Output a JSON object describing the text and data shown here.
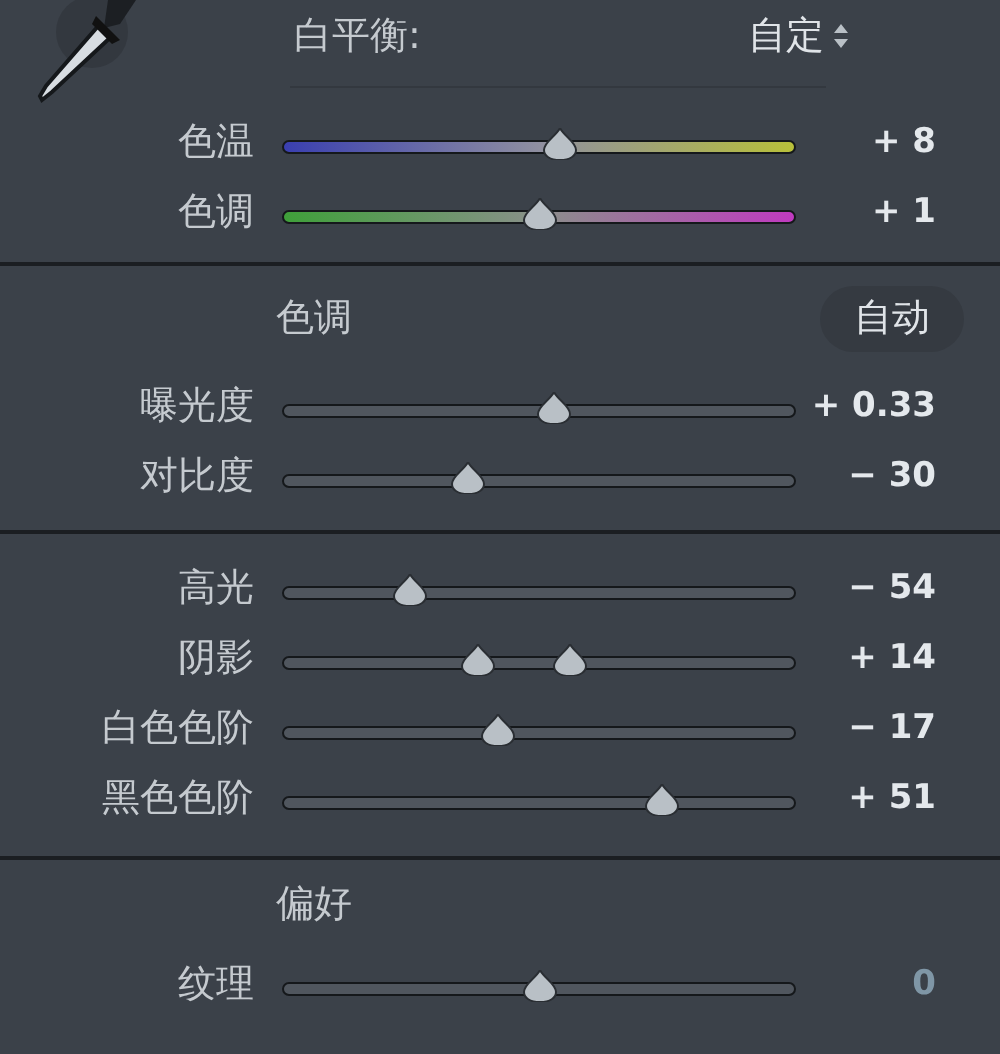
{
  "white_balance": {
    "label": "白平衡:",
    "value": "自定"
  },
  "sections": [
    {
      "sliders": [
        {
          "label": "色温",
          "kind": "temperature",
          "level": 0.54,
          "reading": "+ 8",
          "dimmed": false
        },
        {
          "label": "色调",
          "kind": "tint",
          "level": 0.5,
          "reading": "+ 1",
          "dimmed": false
        }
      ]
    },
    {
      "title": "色调",
      "auto": "自动",
      "sliders": [
        {
          "label": "曝光度",
          "kind": "plain",
          "level": 0.53,
          "reading": "+ 0.33",
          "dimmed": false
        },
        {
          "label": "对比度",
          "kind": "plain",
          "level": 0.36,
          "reading": "− 30",
          "dimmed": false
        }
      ]
    },
    {
      "sliders": [
        {
          "label": "高光",
          "kind": "plain",
          "level": 0.25,
          "reading": "− 54",
          "dimmed": false
        },
        {
          "label": "阴影",
          "kind": "plain",
          "level": 0.56,
          "previous": {
            "level": 0.38
          },
          "reading": "+ 14",
          "dimmed": false
        },
        {
          "label": "白色色阶",
          "kind": "plain",
          "level": 0.42,
          "reading": "− 17",
          "dimmed": false
        },
        {
          "label": "黑色色阶",
          "kind": "plain",
          "level": 0.74,
          "reading": "+ 51",
          "dimmed": false
        }
      ]
    },
    {
      "title": "偏好",
      "sliders": [
        {
          "label": "纹理",
          "kind": "plain",
          "level": 0.5,
          "reading": "0",
          "dimmed": true
        }
      ]
    }
  ]
}
